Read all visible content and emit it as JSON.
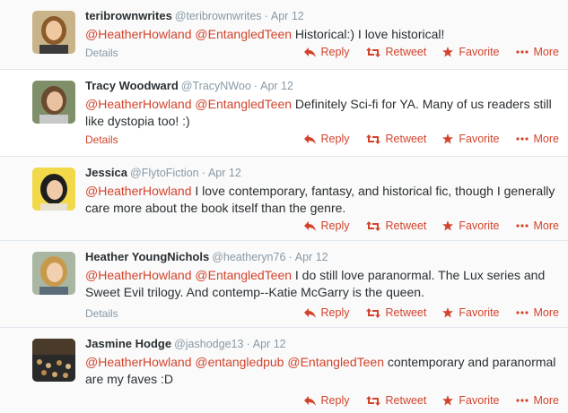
{
  "accent": "#d2432c",
  "actions": {
    "details": "Details",
    "reply": "Reply",
    "retweet": "Retweet",
    "favorite": "Favorite",
    "more": "More"
  },
  "tweets": [
    {
      "fullname": "teribrownwrites",
      "username": "@teribrownwrites",
      "time": "Apr 12",
      "mentions": [
        "@HeatherHowland",
        "@EntangledTeen"
      ],
      "text": " Historical:) I love historical!"
    },
    {
      "fullname": "Tracy Woodward",
      "username": "@TracyNWoo",
      "time": "Apr 12",
      "mentions": [
        "@HeatherHowland",
        "@EntangledTeen"
      ],
      "text": " Definitely Sci-fi for YA. Many of us readers still like dystopia too! :)"
    },
    {
      "fullname": "Jessica",
      "username": "@FlytoFiction",
      "time": "Apr 12",
      "mentions": [
        "@HeatherHowland"
      ],
      "text": " I love contemporary, fantasy, and historical fic, though I generally care more about the book itself than the genre."
    },
    {
      "fullname": "Heather YoungNichols",
      "username": "@heatheryn76",
      "time": "Apr 12",
      "mentions": [
        "@HeatherHowland",
        "@EntangledTeen"
      ],
      "text": " I do still love paranormal. The Lux series and Sweet Evil trilogy. And contemp--Katie McGarry is the queen."
    },
    {
      "fullname": "Jasmine Hodge",
      "username": "@jashodge13",
      "time": "Apr 12",
      "mentions": [
        "@HeatherHowland",
        "@entangledpub",
        "@EntangledTeen"
      ],
      "text": " contemporary and paranormal are my faves :D"
    }
  ]
}
